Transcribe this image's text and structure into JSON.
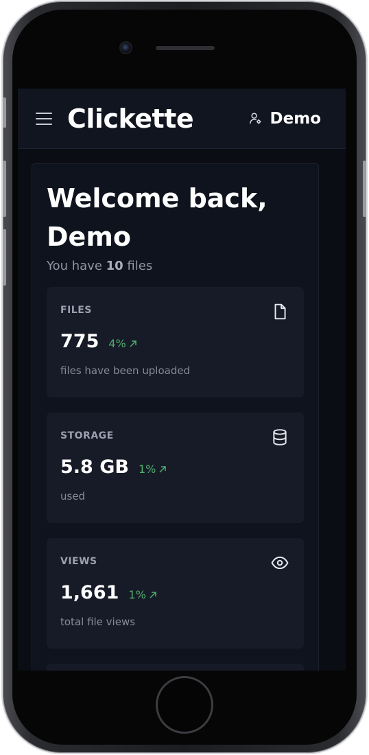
{
  "header": {
    "app_title": "Clickette",
    "user_name": "Demo"
  },
  "welcome": {
    "title": "Welcome back, Demo",
    "subtitle_prefix": "You have ",
    "file_count": "10",
    "subtitle_suffix": " files"
  },
  "stats": [
    {
      "label": "FILES",
      "value": "775",
      "delta": "4%",
      "description": "files have been uploaded",
      "icon": "file-icon"
    },
    {
      "label": "STORAGE",
      "value": "5.8 GB",
      "delta": "1%",
      "description": "used",
      "icon": "database-icon"
    },
    {
      "label": "VIEWS",
      "value": "1,661",
      "delta": "1%",
      "description": "total file views",
      "icon": "eye-icon"
    }
  ],
  "colors": {
    "background": "#0b0d14",
    "header": "#111520",
    "card": "#171b28",
    "delta_positive": "#4fae6a"
  }
}
